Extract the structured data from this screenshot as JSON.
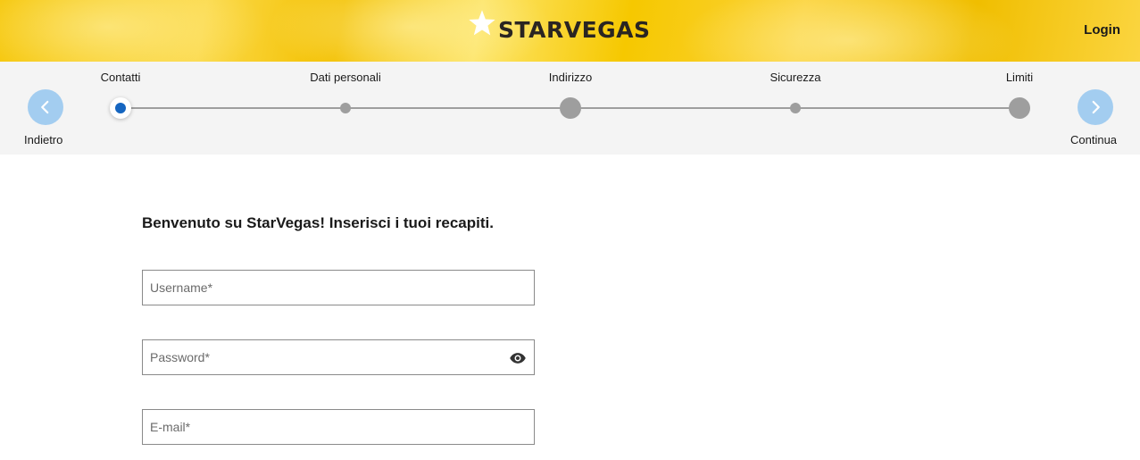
{
  "header": {
    "brand": "STARVEGAS",
    "login_label": "Login",
    "background_color": "#f5c400"
  },
  "stepper": {
    "back_label": "Indietro",
    "next_label": "Continua",
    "nav_button_color": "#a3cdf0",
    "active_color": "#1565c0",
    "steps": [
      {
        "label": "Contatti",
        "state": "active"
      },
      {
        "label": "Dati personali",
        "state": "pending"
      },
      {
        "label": "Indirizzo",
        "state": "pending"
      },
      {
        "label": "Sicurezza",
        "state": "pending"
      },
      {
        "label": "Limiti",
        "state": "pending"
      }
    ]
  },
  "form": {
    "title": "Benvenuto su StarVegas! Inserisci i tuoi recapiti.",
    "username": {
      "value": "",
      "placeholder": "Username*"
    },
    "password": {
      "value": "",
      "placeholder": "Password*",
      "toggle_icon": "eye-icon"
    },
    "email": {
      "value": "",
      "placeholder": "E-mail*"
    }
  }
}
